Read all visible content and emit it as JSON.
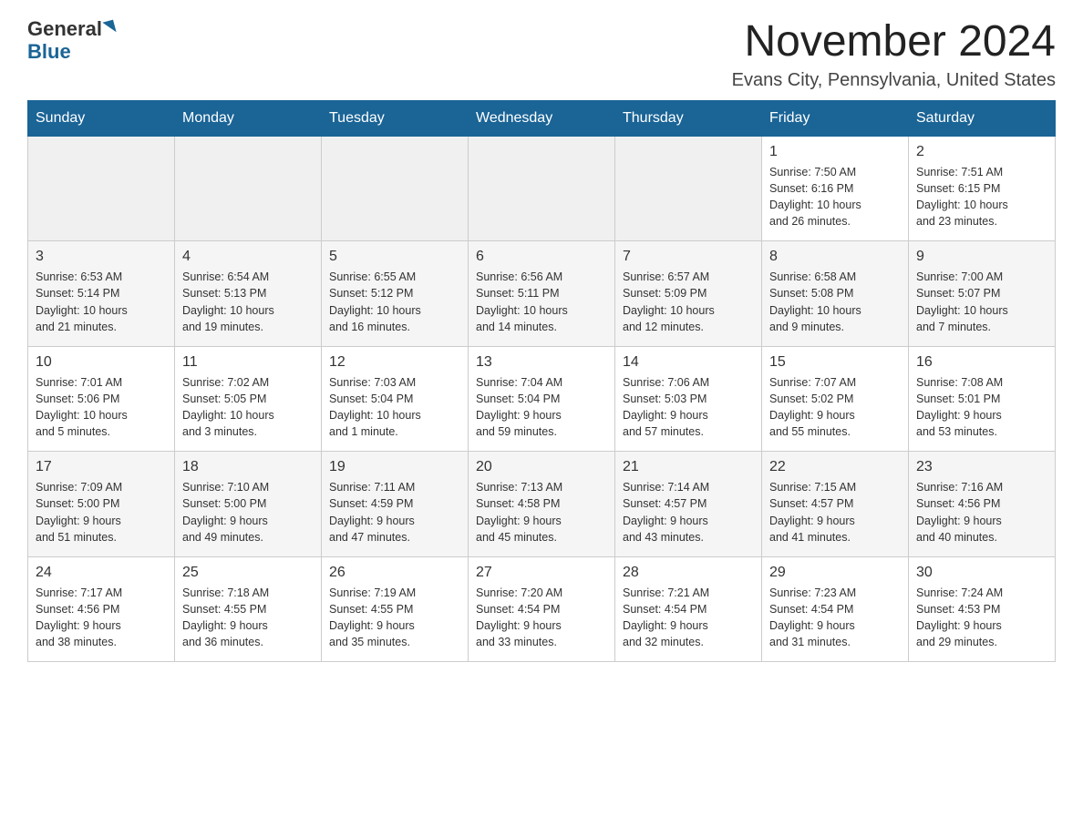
{
  "logo": {
    "name_part1": "General",
    "name_part2": "Blue"
  },
  "header": {
    "month": "November 2024",
    "location": "Evans City, Pennsylvania, United States"
  },
  "weekdays": [
    "Sunday",
    "Monday",
    "Tuesday",
    "Wednesday",
    "Thursday",
    "Friday",
    "Saturday"
  ],
  "weeks": [
    [
      {
        "day": "",
        "info": ""
      },
      {
        "day": "",
        "info": ""
      },
      {
        "day": "",
        "info": ""
      },
      {
        "day": "",
        "info": ""
      },
      {
        "day": "",
        "info": ""
      },
      {
        "day": "1",
        "info": "Sunrise: 7:50 AM\nSunset: 6:16 PM\nDaylight: 10 hours\nand 26 minutes."
      },
      {
        "day": "2",
        "info": "Sunrise: 7:51 AM\nSunset: 6:15 PM\nDaylight: 10 hours\nand 23 minutes."
      }
    ],
    [
      {
        "day": "3",
        "info": "Sunrise: 6:53 AM\nSunset: 5:14 PM\nDaylight: 10 hours\nand 21 minutes."
      },
      {
        "day": "4",
        "info": "Sunrise: 6:54 AM\nSunset: 5:13 PM\nDaylight: 10 hours\nand 19 minutes."
      },
      {
        "day": "5",
        "info": "Sunrise: 6:55 AM\nSunset: 5:12 PM\nDaylight: 10 hours\nand 16 minutes."
      },
      {
        "day": "6",
        "info": "Sunrise: 6:56 AM\nSunset: 5:11 PM\nDaylight: 10 hours\nand 14 minutes."
      },
      {
        "day": "7",
        "info": "Sunrise: 6:57 AM\nSunset: 5:09 PM\nDaylight: 10 hours\nand 12 minutes."
      },
      {
        "day": "8",
        "info": "Sunrise: 6:58 AM\nSunset: 5:08 PM\nDaylight: 10 hours\nand 9 minutes."
      },
      {
        "day": "9",
        "info": "Sunrise: 7:00 AM\nSunset: 5:07 PM\nDaylight: 10 hours\nand 7 minutes."
      }
    ],
    [
      {
        "day": "10",
        "info": "Sunrise: 7:01 AM\nSunset: 5:06 PM\nDaylight: 10 hours\nand 5 minutes."
      },
      {
        "day": "11",
        "info": "Sunrise: 7:02 AM\nSunset: 5:05 PM\nDaylight: 10 hours\nand 3 minutes."
      },
      {
        "day": "12",
        "info": "Sunrise: 7:03 AM\nSunset: 5:04 PM\nDaylight: 10 hours\nand 1 minute."
      },
      {
        "day": "13",
        "info": "Sunrise: 7:04 AM\nSunset: 5:04 PM\nDaylight: 9 hours\nand 59 minutes."
      },
      {
        "day": "14",
        "info": "Sunrise: 7:06 AM\nSunset: 5:03 PM\nDaylight: 9 hours\nand 57 minutes."
      },
      {
        "day": "15",
        "info": "Sunrise: 7:07 AM\nSunset: 5:02 PM\nDaylight: 9 hours\nand 55 minutes."
      },
      {
        "day": "16",
        "info": "Sunrise: 7:08 AM\nSunset: 5:01 PM\nDaylight: 9 hours\nand 53 minutes."
      }
    ],
    [
      {
        "day": "17",
        "info": "Sunrise: 7:09 AM\nSunset: 5:00 PM\nDaylight: 9 hours\nand 51 minutes."
      },
      {
        "day": "18",
        "info": "Sunrise: 7:10 AM\nSunset: 5:00 PM\nDaylight: 9 hours\nand 49 minutes."
      },
      {
        "day": "19",
        "info": "Sunrise: 7:11 AM\nSunset: 4:59 PM\nDaylight: 9 hours\nand 47 minutes."
      },
      {
        "day": "20",
        "info": "Sunrise: 7:13 AM\nSunset: 4:58 PM\nDaylight: 9 hours\nand 45 minutes."
      },
      {
        "day": "21",
        "info": "Sunrise: 7:14 AM\nSunset: 4:57 PM\nDaylight: 9 hours\nand 43 minutes."
      },
      {
        "day": "22",
        "info": "Sunrise: 7:15 AM\nSunset: 4:57 PM\nDaylight: 9 hours\nand 41 minutes."
      },
      {
        "day": "23",
        "info": "Sunrise: 7:16 AM\nSunset: 4:56 PM\nDaylight: 9 hours\nand 40 minutes."
      }
    ],
    [
      {
        "day": "24",
        "info": "Sunrise: 7:17 AM\nSunset: 4:56 PM\nDaylight: 9 hours\nand 38 minutes."
      },
      {
        "day": "25",
        "info": "Sunrise: 7:18 AM\nSunset: 4:55 PM\nDaylight: 9 hours\nand 36 minutes."
      },
      {
        "day": "26",
        "info": "Sunrise: 7:19 AM\nSunset: 4:55 PM\nDaylight: 9 hours\nand 35 minutes."
      },
      {
        "day": "27",
        "info": "Sunrise: 7:20 AM\nSunset: 4:54 PM\nDaylight: 9 hours\nand 33 minutes."
      },
      {
        "day": "28",
        "info": "Sunrise: 7:21 AM\nSunset: 4:54 PM\nDaylight: 9 hours\nand 32 minutes."
      },
      {
        "day": "29",
        "info": "Sunrise: 7:23 AM\nSunset: 4:54 PM\nDaylight: 9 hours\nand 31 minutes."
      },
      {
        "day": "30",
        "info": "Sunrise: 7:24 AM\nSunset: 4:53 PM\nDaylight: 9 hours\nand 29 minutes."
      }
    ]
  ]
}
